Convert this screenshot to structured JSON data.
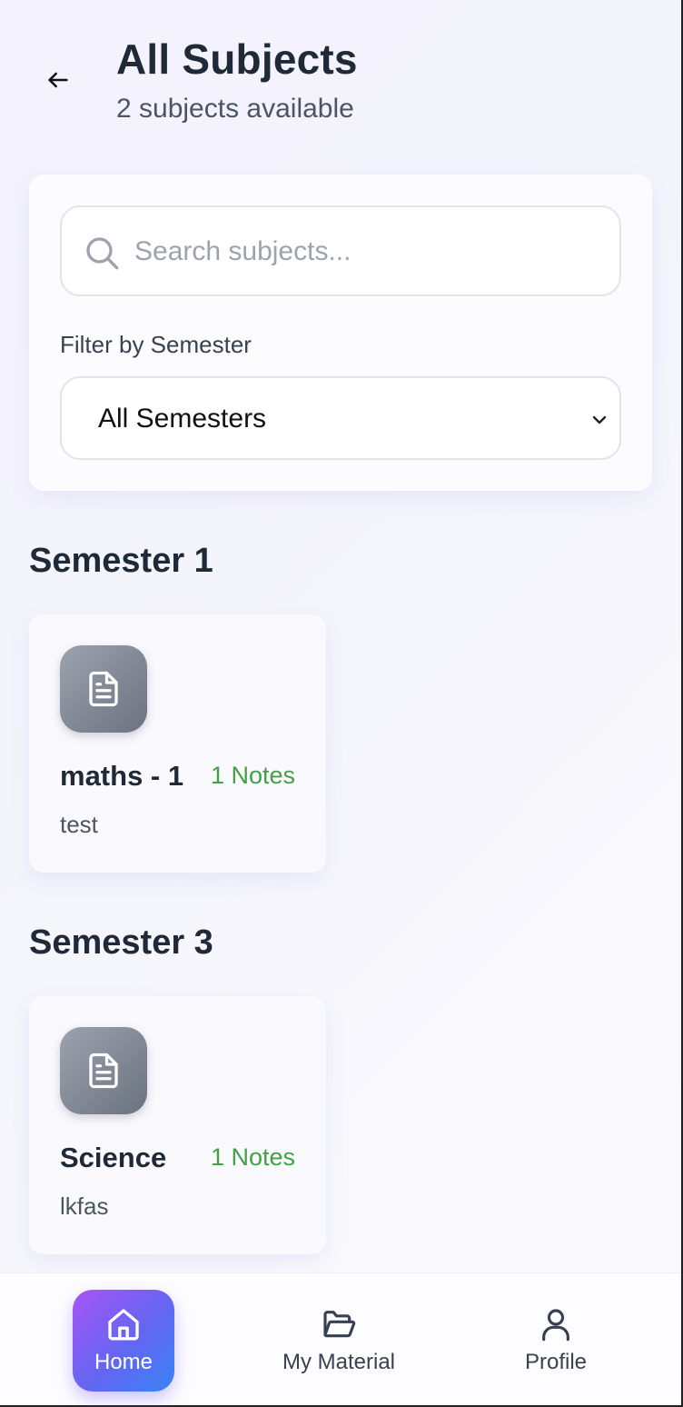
{
  "header": {
    "title": "All Subjects",
    "subtitle": "2 subjects available"
  },
  "search": {
    "placeholder": "Search subjects...",
    "value": ""
  },
  "filter": {
    "label": "Filter by Semester",
    "selected": "All Semesters"
  },
  "sections": [
    {
      "title": "Semester 1",
      "subjects": [
        {
          "name": "maths - 1",
          "notes": "1 Notes",
          "description": "test"
        }
      ]
    },
    {
      "title": "Semester 3",
      "subjects": [
        {
          "name": "Science",
          "notes": "1 Notes",
          "description": "lkfas"
        }
      ]
    }
  ],
  "nav": {
    "home": "Home",
    "material": "My Material",
    "profile": "Profile"
  },
  "colors": {
    "notes_green": "#43a047",
    "accent_gradient_start": "#a855f7",
    "accent_gradient_end": "#3b82f6",
    "doc_tile": "#7b818c"
  },
  "icons": {
    "back": "arrow-left-icon",
    "search": "search-icon",
    "select": "chevron-down-icon",
    "subject": "document-icon",
    "home": "home-icon",
    "material": "folder-open-icon",
    "profile": "user-icon"
  }
}
